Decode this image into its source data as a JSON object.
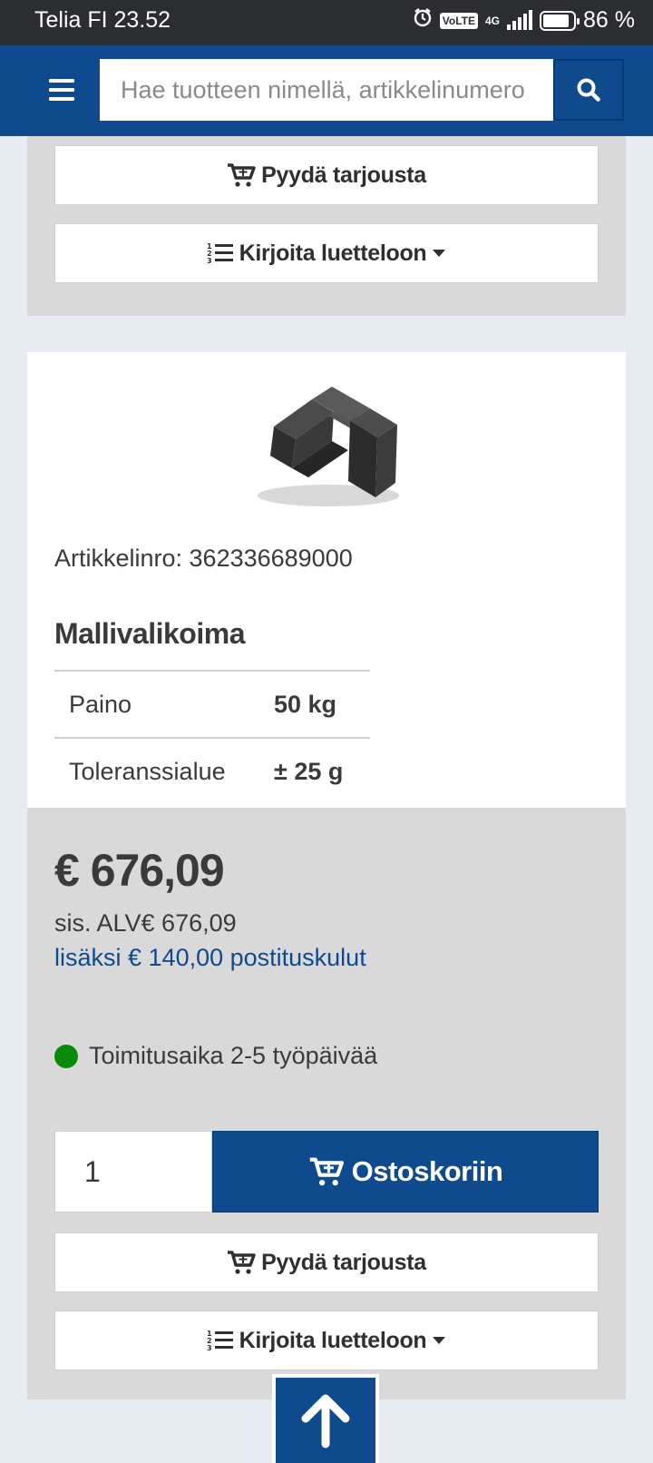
{
  "status_bar": {
    "carrier_time": "Telia FI 23.52",
    "volte": "VoLTE",
    "network": "4G",
    "battery_text": "86 %",
    "battery_level": 0.86,
    "icons": [
      "alarm-icon",
      "signal-icon",
      "battery-icon"
    ]
  },
  "header": {
    "menu_icon": "hamburger-icon",
    "search_placeholder": "Hae tuotteen nimellä, artikkelinumero",
    "search_icon": "search-icon",
    "brand_color": "#0f4a8f"
  },
  "top_actions": {
    "quote_label": "Pyydä tarjousta",
    "list_label": "Kirjoita luetteloon"
  },
  "product": {
    "article_label": "Artikkelinro: 362336689000",
    "section_title": "Mallivalikoima",
    "specs": [
      {
        "key": "Paino",
        "value": "50 kg"
      },
      {
        "key": "Toleranssialue",
        "value": "± 25 g"
      }
    ]
  },
  "pricing": {
    "price": "€ 676,09",
    "vat_text": "sis. ALV€ 676,09",
    "shipping_text": "lisäksi € 140,00 postituskulut",
    "delivery_text": "Toimitusaika 2-5 työpäivää",
    "delivery_status_color": "#0a8a0a"
  },
  "purchase": {
    "quantity": "1",
    "cart_label": "Ostoskoriin",
    "quote_label": "Pyydä tarjousta",
    "list_label": "Kirjoita luetteloon"
  },
  "scroll_top_icon": "arrow-up-icon"
}
